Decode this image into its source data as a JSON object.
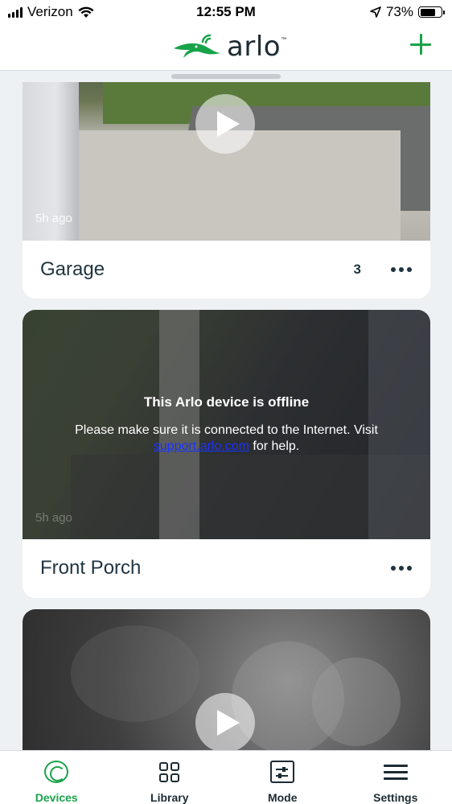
{
  "status_bar": {
    "carrier": "Verizon",
    "time": "12:55 PM",
    "battery": "73%",
    "battery_level": 0.73,
    "icons": [
      "signal-icon",
      "wifi-icon",
      "location-arrow-icon",
      "battery-icon"
    ]
  },
  "header": {
    "logo_text": "arlo",
    "logo_tm": "™",
    "add_icon": "plus-icon",
    "accent_color": "#18a34a"
  },
  "cards": [
    {
      "name": "Garage",
      "timestamp": "5h ago",
      "count": "3",
      "has_play": true
    },
    {
      "name": "Front Porch",
      "timestamp": "5h ago",
      "offline_title": "This Arlo device is offline",
      "offline_message": "Please make sure it is connected to the Internet. Visit",
      "offline_link": "support.arlo.com",
      "offline_suffix": "for help."
    },
    {
      "has_play": true
    }
  ],
  "tabs": [
    {
      "label": "Devices",
      "icon": "devices-icon",
      "active": true
    },
    {
      "label": "Library",
      "icon": "library-grid-icon",
      "active": false
    },
    {
      "label": "Mode",
      "icon": "mode-sliders-icon",
      "active": false
    },
    {
      "label": "Settings",
      "icon": "settings-menu-icon",
      "active": false
    }
  ]
}
